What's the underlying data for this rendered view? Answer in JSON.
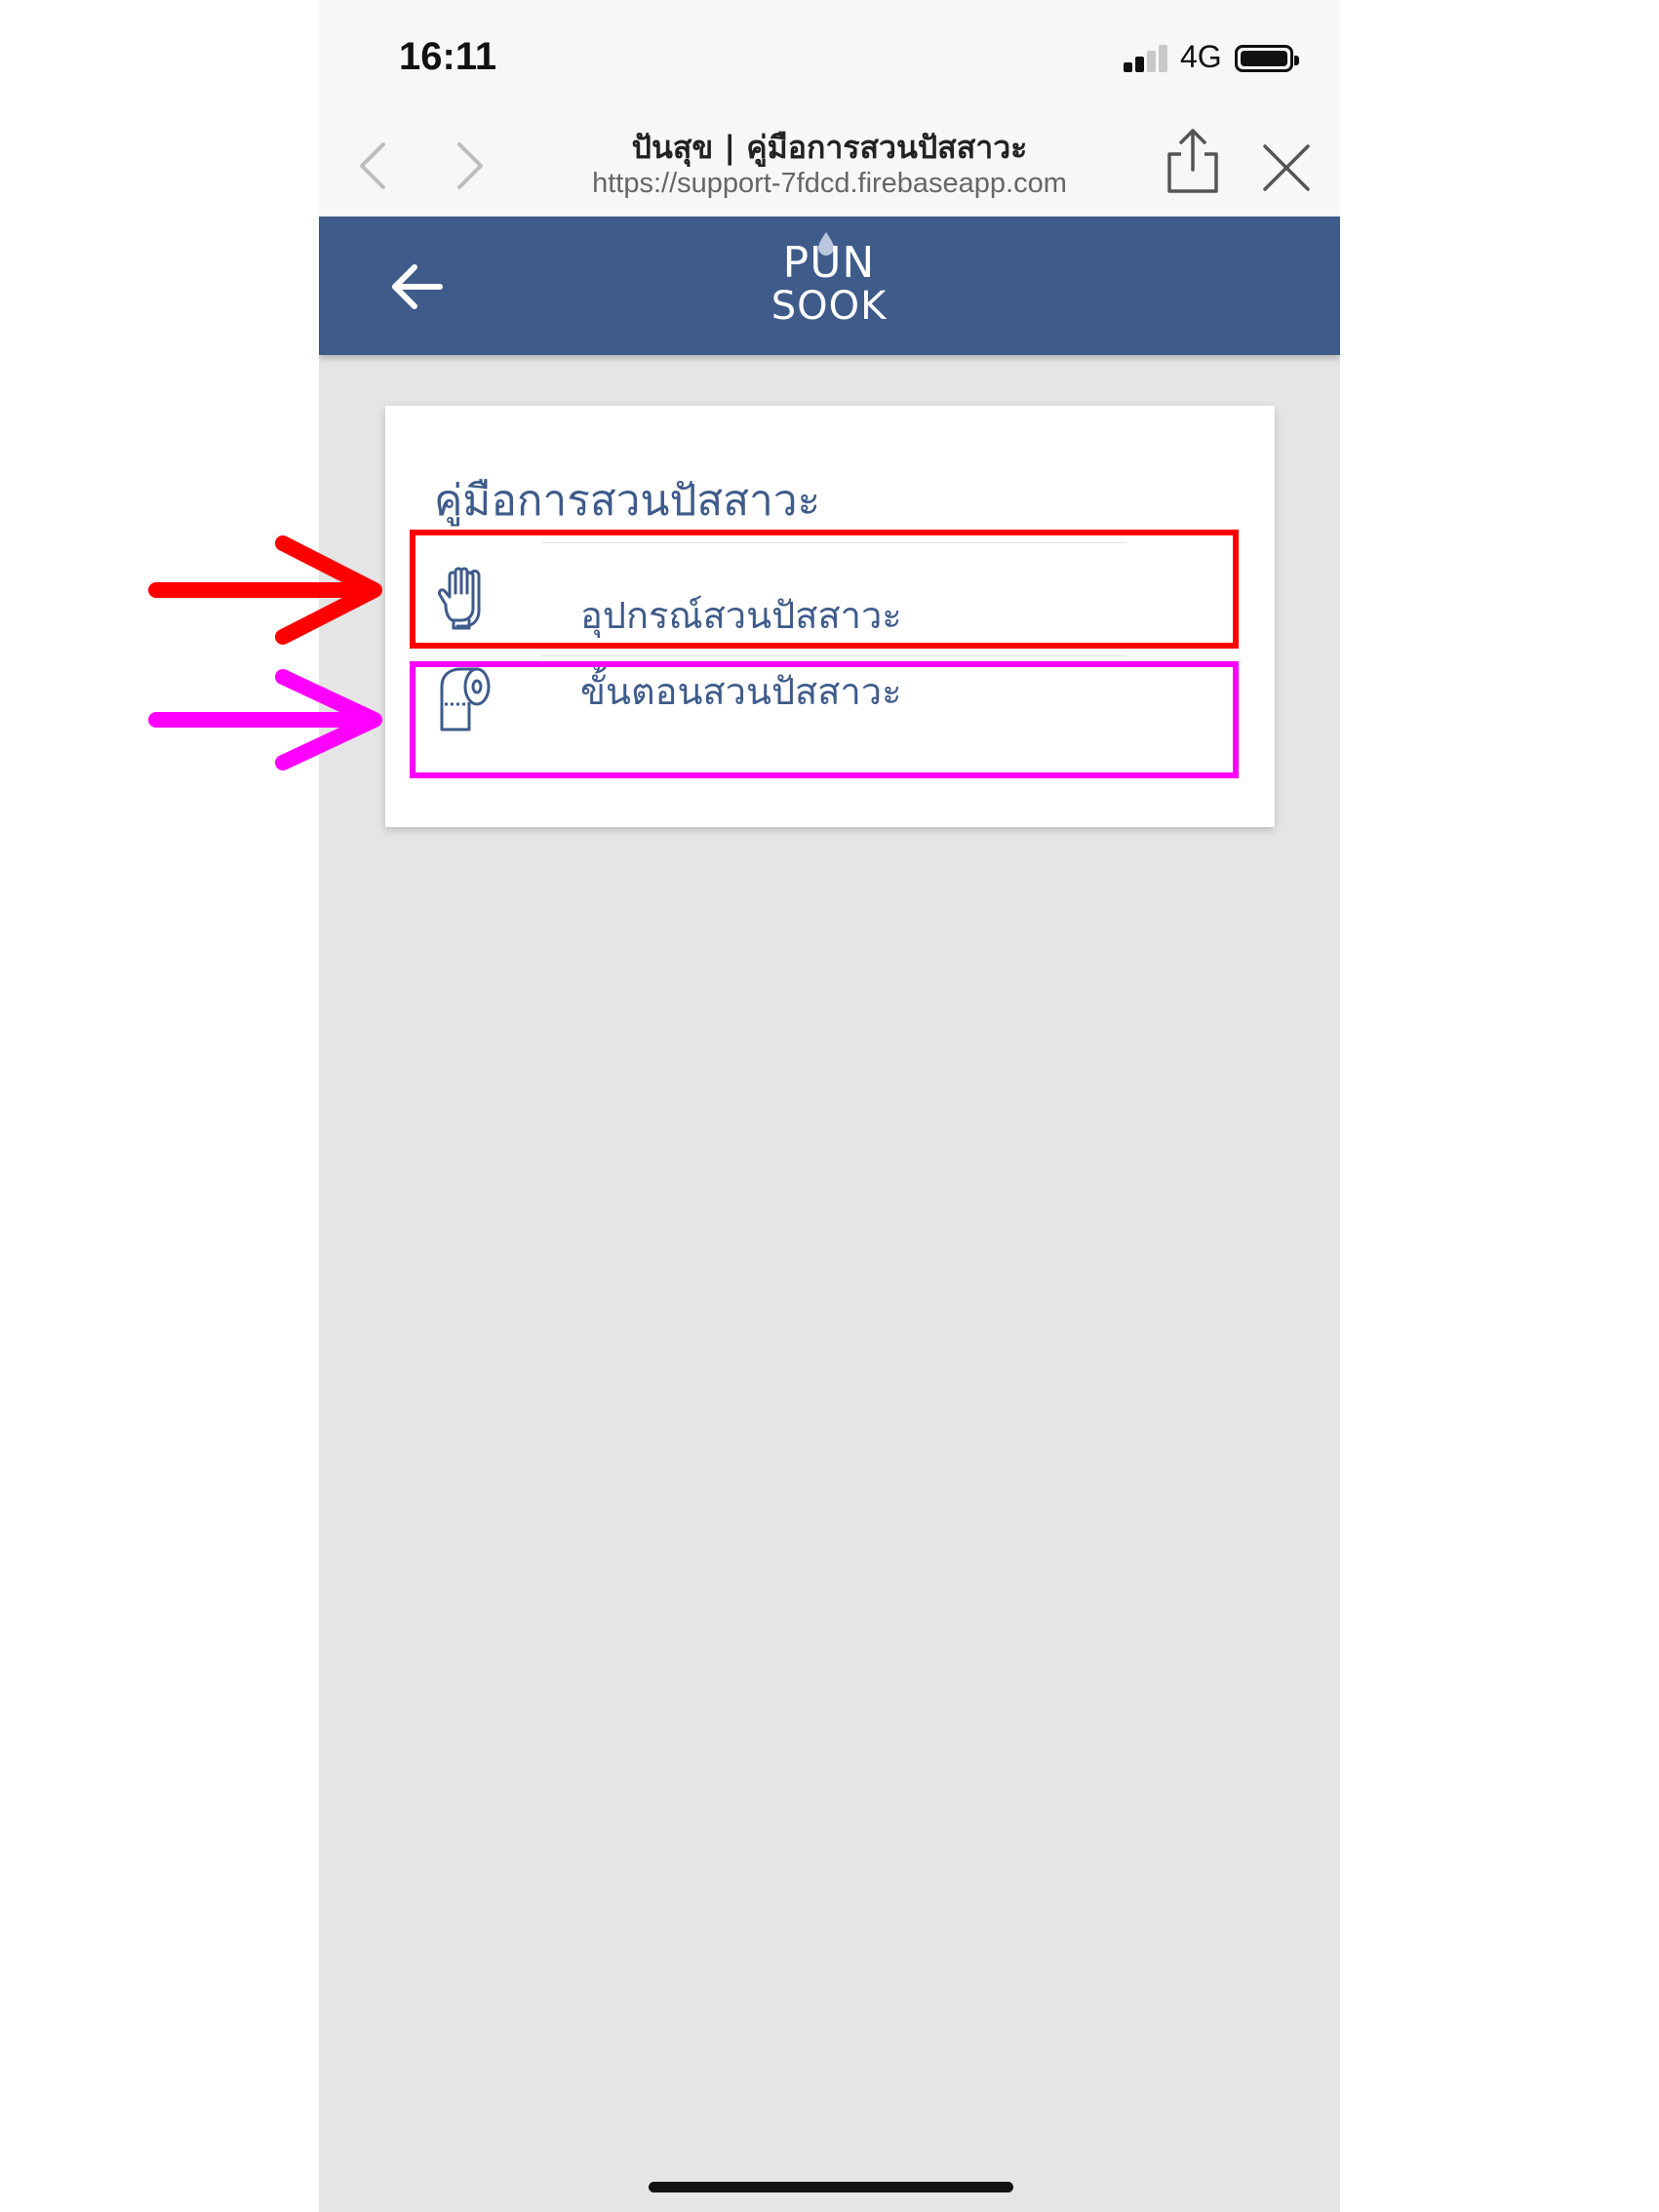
{
  "status_bar": {
    "time": "16:11",
    "network": "4G"
  },
  "browser": {
    "page_title": "ปันสุข | คู่มือการสวนปัสสาวะ",
    "url": "https://support-7fdcd.firebaseapp.com"
  },
  "appbar": {
    "logo_line1": "PUN",
    "logo_line2": "SOOK"
  },
  "card": {
    "title": "คู่มือการสวนปัสสาวะ",
    "items": [
      {
        "label": "อุปกรณ์สวนปัสสาวะ",
        "icon": "glove-icon"
      },
      {
        "label": "ขั้นตอนสวนปัสสาวะ",
        "icon": "toilet-paper-icon"
      }
    ]
  },
  "colors": {
    "brand": "#3e5b8a",
    "annotation_red": "#ff0000",
    "annotation_magenta": "#ff00ff",
    "background": "#e5e5e5"
  }
}
